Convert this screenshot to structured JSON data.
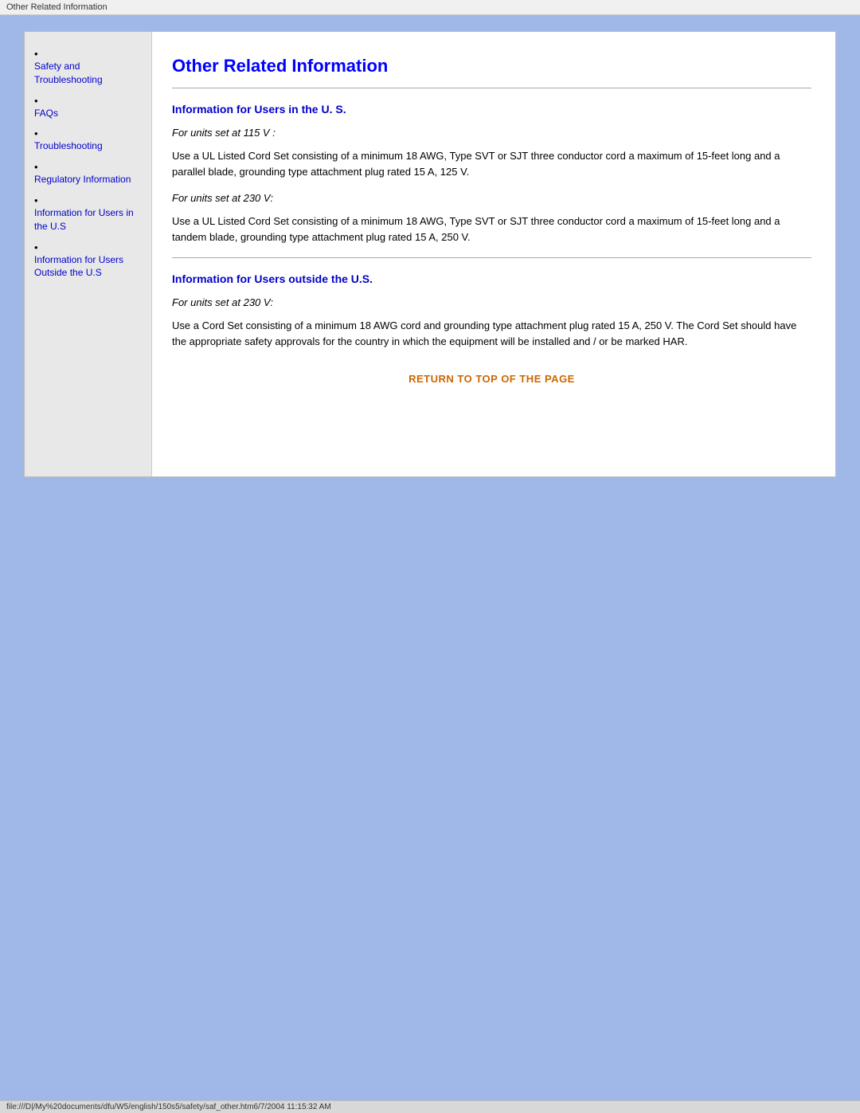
{
  "title_bar": {
    "text": "Other Related Information"
  },
  "sidebar": {
    "items": [
      {
        "label": "Safety and Troubleshooting",
        "id": "safety-troubleshooting"
      },
      {
        "label": "FAQs",
        "id": "faqs"
      },
      {
        "label": "Troubleshooting",
        "id": "troubleshooting"
      },
      {
        "label": "Regulatory Information",
        "id": "regulatory-info"
      },
      {
        "label": "Information for Users in the U.S",
        "id": "info-users-us"
      },
      {
        "label": "Information for Users Outside the U.S",
        "id": "info-users-outside"
      }
    ]
  },
  "content": {
    "page_title": "Other Related Information",
    "section1": {
      "title": "Information for Users in the U. S.",
      "note1": "For units set at 115 V :",
      "body1": "Use a UL Listed Cord Set consisting of a minimum 18 AWG, Type SVT or SJT three conductor cord a maximum of 15-feet long and a parallel blade, grounding type attachment plug rated 15 A, 125 V.",
      "note2": "For units set at 230 V:",
      "body2": "Use a UL Listed Cord Set consisting of a minimum 18 AWG, Type SVT or SJT three conductor cord a maximum of 15-feet long and a tandem blade, grounding type attachment plug rated 15 A, 250 V."
    },
    "section2": {
      "title": "Information for Users outside the U.S.",
      "note1": "For units set at 230 V:",
      "body1": "Use a Cord Set consisting of a minimum 18 AWG cord and grounding type attachment plug rated 15 A, 250 V. The Cord Set should have the appropriate safety approvals for the country in which the equipment will be installed and / or be marked HAR."
    },
    "return_link": "RETURN TO TOP OF THE PAGE"
  },
  "status_bar": {
    "text": "file:///D|/My%20documents/dfu/W5/english/150s5/safety/saf_other.htm6/7/2004 11:15:32 AM"
  }
}
